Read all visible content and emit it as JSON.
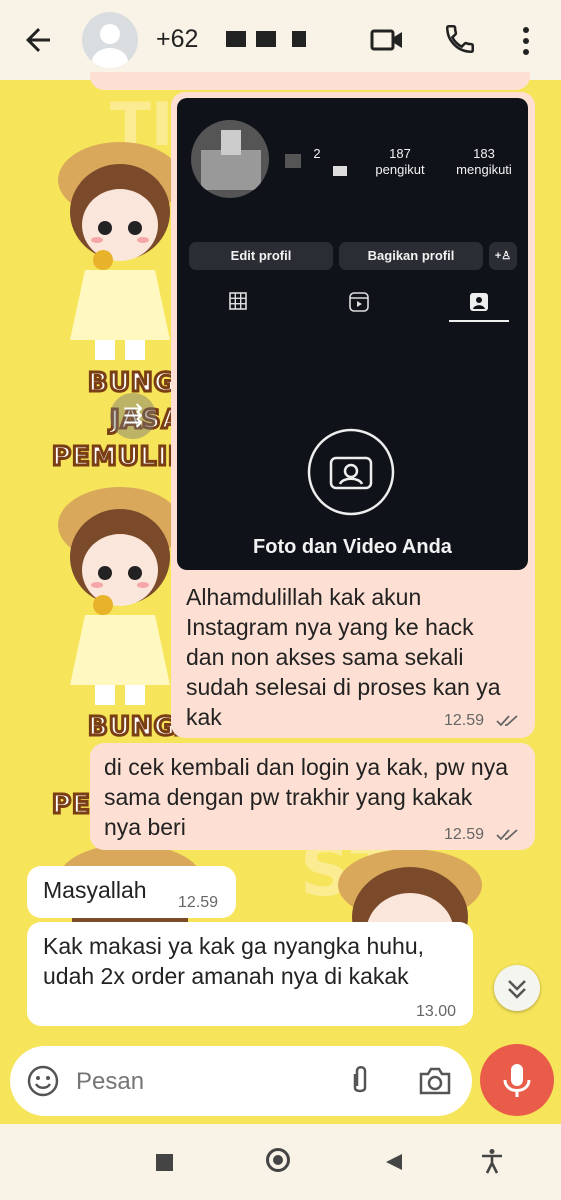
{
  "header": {
    "contact_name": "+62",
    "back_icon": "back-arrow-icon",
    "video_icon": "video-call-icon",
    "call_icon": "phone-icon",
    "menu_icon": "more-vert-icon"
  },
  "wallpaper": {
    "label_1": "BUNGA",
    "label_2": "JASA",
    "label_3": "PEMULIH",
    "label_4": "BUNGA",
    "label_5": "PE"
  },
  "instagram_card": {
    "posts": "2",
    "followers_count": "187",
    "followers_label": "pengikut",
    "following_count": "183",
    "following_label": "mengikuti",
    "edit_profile": "Edit profil",
    "share_profile": "Bagikan profil",
    "empty_title": "Foto dan Video Anda"
  },
  "messages": [
    {
      "direction": "out",
      "text": "Alhamdulillah kak akun Instagram nya yang ke hack dan non akses sama sekali sudah selesai di proses kan ya kak",
      "time": "12.59",
      "status": "read"
    },
    {
      "direction": "out",
      "text": "di cek kembali dan login ya kak, pw nya sama dengan pw trakhir yang kakak nya beri",
      "time": "12.59",
      "status": "read"
    },
    {
      "direction": "in",
      "text": "Masyallah",
      "time": "12.59"
    },
    {
      "direction": "in",
      "text": "Kak makasi ya kak ga nyangka huhu, udah 2x order amanah nya di kakak",
      "time": "13.00"
    }
  ],
  "composer": {
    "placeholder": "Pesan",
    "emoji_icon": "emoji-icon",
    "attach_icon": "attach-icon",
    "camera_icon": "camera-icon",
    "mic_icon": "mic-icon",
    "scroll_icon": "scroll-down-icon"
  },
  "nav": {
    "recents_icon": "square-nav-icon",
    "home_icon": "home-nav-icon",
    "back_icon": "back-nav-icon",
    "accessibility_icon": "accessibility-icon"
  },
  "colors": {
    "wallpaper": "#f6e45a",
    "outgoing_bubble": "#fde0d3",
    "incoming_bubble": "#ffffff",
    "mic_button": "#e95c4a",
    "header": "#f8f3e6"
  }
}
